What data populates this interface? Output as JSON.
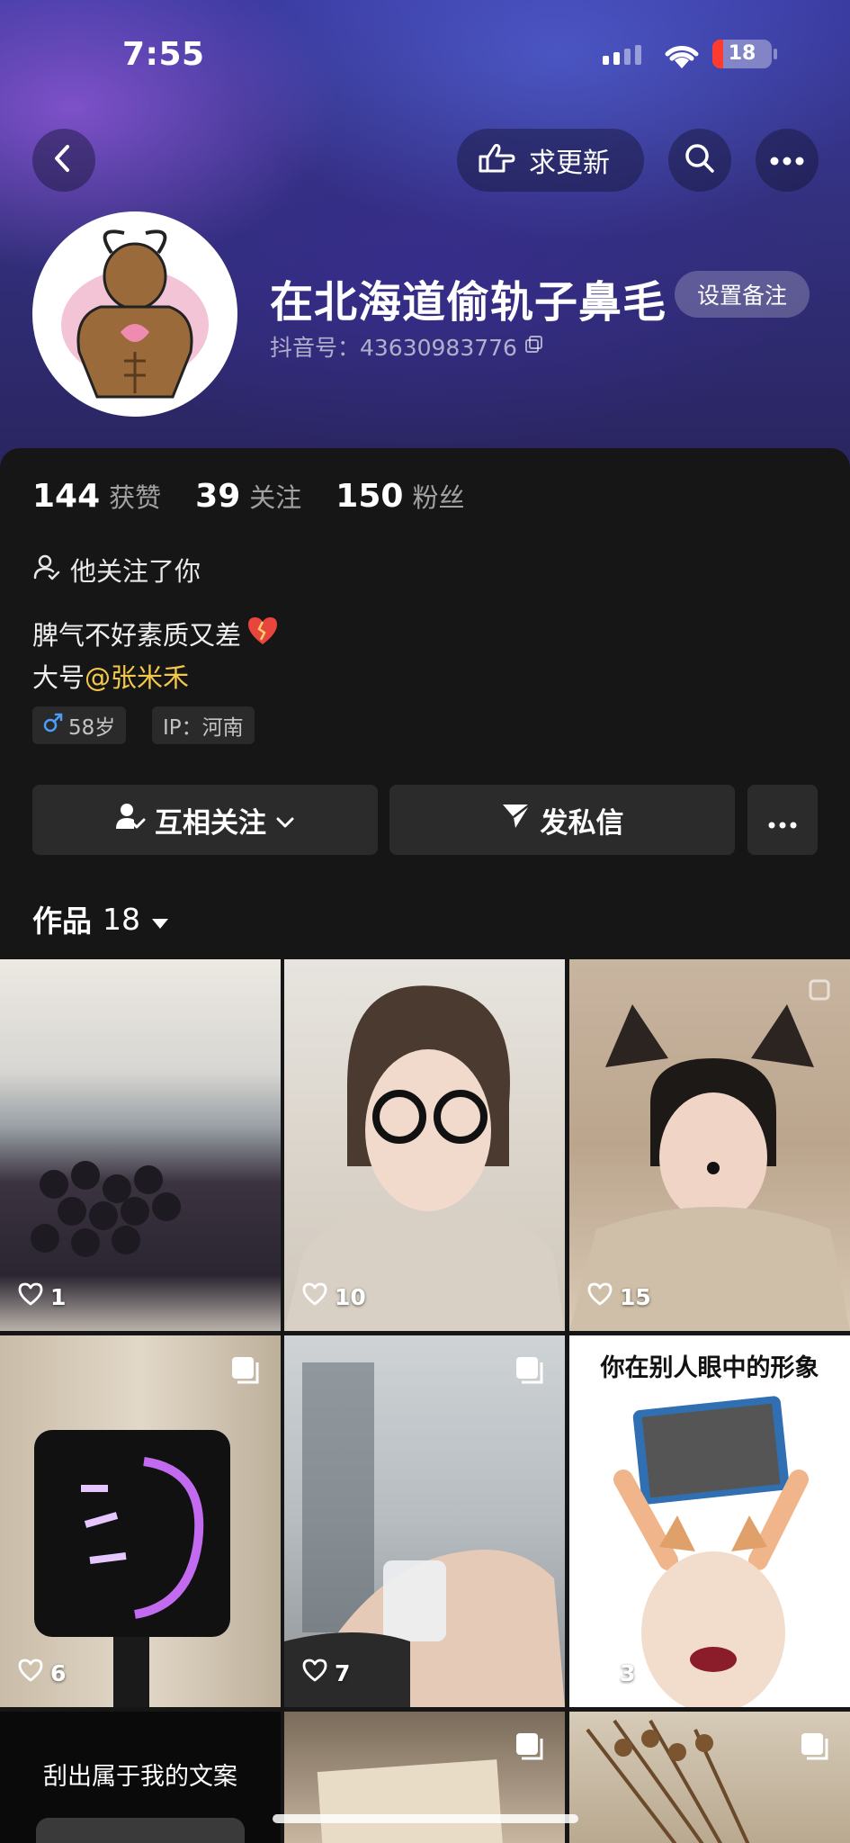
{
  "status_bar": {
    "time": "7:55",
    "battery": "18",
    "battery_level": 0.18
  },
  "top_nav": {
    "update_label": "求更新"
  },
  "profile": {
    "nickname": "在北海道偷轨子鼻毛",
    "remark_label": "设置备注",
    "douyin_id": "抖音号：43630983776"
  },
  "stats": [
    {
      "value": "144",
      "label": "获赞"
    },
    {
      "value": "39",
      "label": "关注"
    },
    {
      "value": "150",
      "label": "粉丝"
    }
  ],
  "follows_you": "他关注了你",
  "bio": {
    "line1": "脾气不好素质又差",
    "line2_prefix": "大号",
    "mention": "@张米禾"
  },
  "tags": {
    "age": "58岁",
    "ip": "IP：河南"
  },
  "actions": {
    "mutual_follow": "互相关注",
    "message": "发私信"
  },
  "works": {
    "label": "作品",
    "count": "18"
  },
  "grid": [
    {
      "likes": "1",
      "caption": "",
      "overlay_text": ""
    },
    {
      "likes": "10",
      "caption": "",
      "overlay_text": ""
    },
    {
      "likes": "15",
      "caption": "",
      "overlay_text": ""
    },
    {
      "likes": "6",
      "caption": "",
      "overlay_text": ""
    },
    {
      "likes": "7",
      "caption": "",
      "overlay_text": ""
    },
    {
      "likes": "3",
      "caption": "你在别人眼中的形象",
      "overlay_text": ""
    },
    {
      "likes": "",
      "caption": "",
      "overlay_text": "刮出属于我的文案"
    },
    {
      "likes": "",
      "caption": "",
      "overlay_text": ""
    },
    {
      "likes": "",
      "caption": "",
      "overlay_text": ""
    }
  ],
  "colors": {
    "mention": "#f3c84a",
    "background": "#161616",
    "header": "#33307e"
  },
  "icons": [
    "back-icon",
    "pointing-hand-icon",
    "search-icon",
    "more-icon",
    "copy-icon",
    "user-follow-icon",
    "male-icon",
    "send-icon",
    "chevron-down-icon",
    "caret-down-icon",
    "heart-icon",
    "multi-image-icon"
  ]
}
